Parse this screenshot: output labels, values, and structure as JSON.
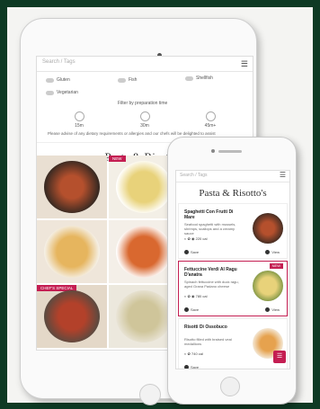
{
  "tablet": {
    "search_placeholder": "Search / Tags",
    "filters": [
      "Gluten",
      "Fish",
      "Shellfish",
      "Vegetarian"
    ],
    "prep_label": "Filter by preparation time",
    "times": [
      "15m",
      "30m",
      "45m+"
    ],
    "note": "Please advise of any dietary requirements or allergies and our chefs will be delighted to assist",
    "title": "Pasta & Risotto's",
    "ribbons": [
      "NEW",
      "CHEF'S SPECIAL"
    ]
  },
  "phone": {
    "search_placeholder": "Search / Tags",
    "title": "Pasta & Risotto's",
    "items": [
      {
        "name": "Spaghetti Con Frutti Di Mare",
        "desc": "Seafood spaghetti with mussels, shrimps, scallops and a creamy sauce",
        "cal": "220 cal",
        "save": "Save",
        "view": "View",
        "badge": ""
      },
      {
        "name": "Fettuccine Verdi Al Ragu D'anatra",
        "desc": "Spinach fettuccine with duck ragu, aged Grana Padano cheese",
        "cal": "780 cal",
        "save": "Save",
        "view": "View",
        "badge": "NEW"
      },
      {
        "name": "Risotti Di Ossobuco",
        "desc": "Risotto filled with braised veal medallions",
        "cal": "740 cal",
        "save": "Save",
        "view": "",
        "badge": ""
      }
    ]
  },
  "colors": {
    "accent": "#c41e52",
    "background": "#0e3a24"
  }
}
